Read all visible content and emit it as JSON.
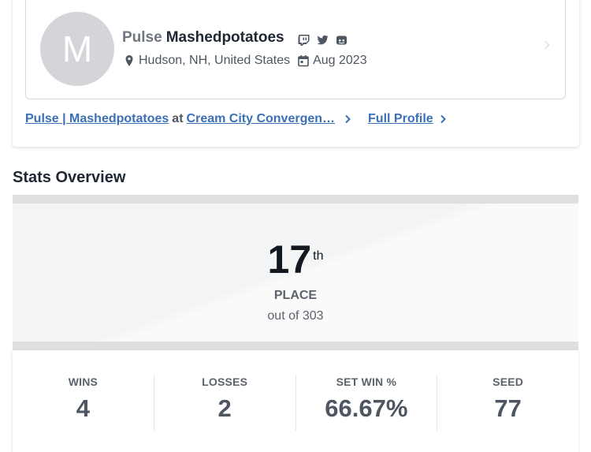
{
  "profile": {
    "avatar_initial": "M",
    "prefix": "Pulse",
    "gamertag": "Mashedpotatoes",
    "socials": [
      "twitch-icon",
      "twitter-icon",
      "discord-icon"
    ],
    "location": "Hudson, NH, United States",
    "joined": "Aug 2023"
  },
  "links": {
    "event_player": "Pulse | Mashedpotatoes",
    "at_word": "at",
    "event_name": "Cream City Convergen…",
    "full_profile": "Full Profile"
  },
  "stats": {
    "title": "Stats Overview",
    "placement": {
      "number": "17",
      "suffix": "th",
      "label": "PLACE",
      "total": "out of 303"
    },
    "items": [
      {
        "label": "WINS",
        "value": "4"
      },
      {
        "label": "LOSSES",
        "value": "2"
      },
      {
        "label": "SET WIN %",
        "value": "66.67%"
      },
      {
        "label": "SEED",
        "value": "77"
      }
    ]
  },
  "colors": {
    "link": "#3b6fb6",
    "text_dark": "#1f2733",
    "text_muted": "#5c636d",
    "avatar_bg": "#d3d5d8",
    "panel_band": "#dddfe1"
  }
}
